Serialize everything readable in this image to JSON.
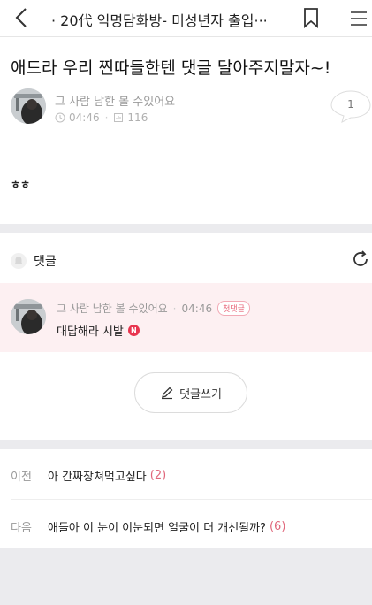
{
  "header": {
    "title": "· 20代 익명담화방- 미성년자 출입···",
    "back_icon": "chevron-left-icon",
    "bookmark_icon": "bookmark-icon",
    "menu_icon": "hamburger-menu-icon"
  },
  "post": {
    "title": "애드라 우리 찐따들한텐 댓글 달아주지말자~!",
    "author": "그 사람 남한 볼 수있어요",
    "time": "04:46",
    "views": "116",
    "comment_count": "1",
    "body": "ㅎㅎ"
  },
  "comments": {
    "header": "댓글",
    "items": [
      {
        "author": "그 사람 남한 볼 수있어요",
        "time": "04:46",
        "badge": "첫댓글",
        "text": "대답해라 시발",
        "new_mark": "N"
      }
    ],
    "write_button": "댓글쓰기"
  },
  "nav": {
    "prev_label": "이전",
    "prev_title": "아 간짜장쳐먹고싶다",
    "prev_count": "(2)",
    "next_label": "다음",
    "next_title": "애들아 이 눈이 이눈되면 얼굴이 더 개선될까?",
    "next_count": "(6)"
  },
  "colors": {
    "accent": "#e8354f",
    "comment_highlight": "#fdf0f2",
    "background": "#ebebee"
  }
}
